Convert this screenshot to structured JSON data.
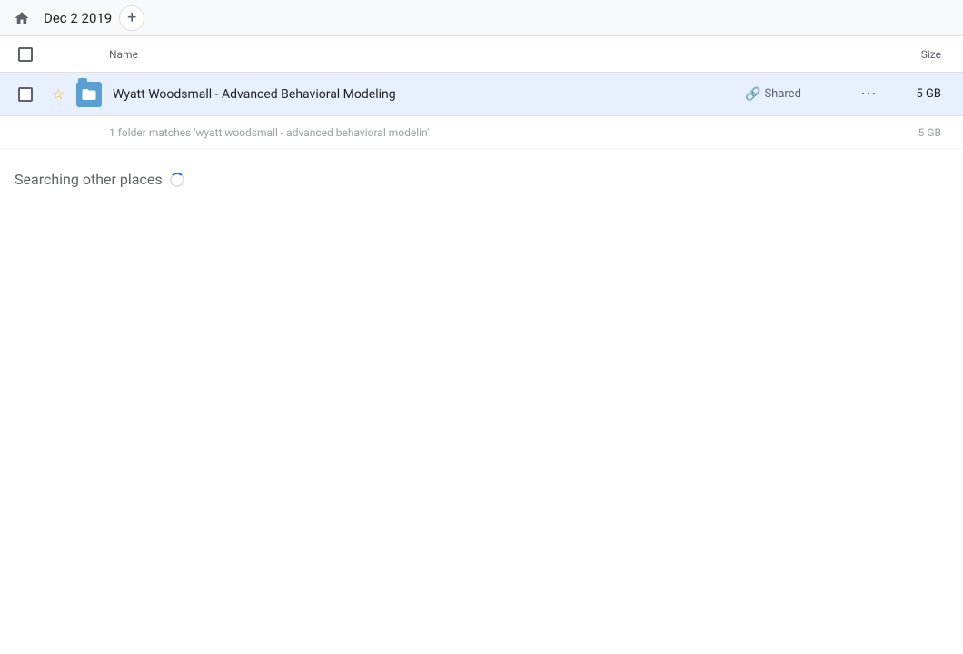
{
  "topbar": {
    "home_icon": "🏠",
    "breadcrumb": "Dec 2 2019",
    "add_icon": "+"
  },
  "columns": {
    "name_label": "Name",
    "size_label": "Size"
  },
  "file_row": {
    "name": "Wyatt Woodsmall - Advanced Behavioral Modeling",
    "shared_label": "Shared",
    "size": "5 GB",
    "more_icon": "⋯"
  },
  "match_summary": {
    "text": "1 folder matches 'wyatt woodsmall - advanced behavioral modelin'",
    "size": "5 GB"
  },
  "searching": {
    "label": "Searching other places"
  }
}
